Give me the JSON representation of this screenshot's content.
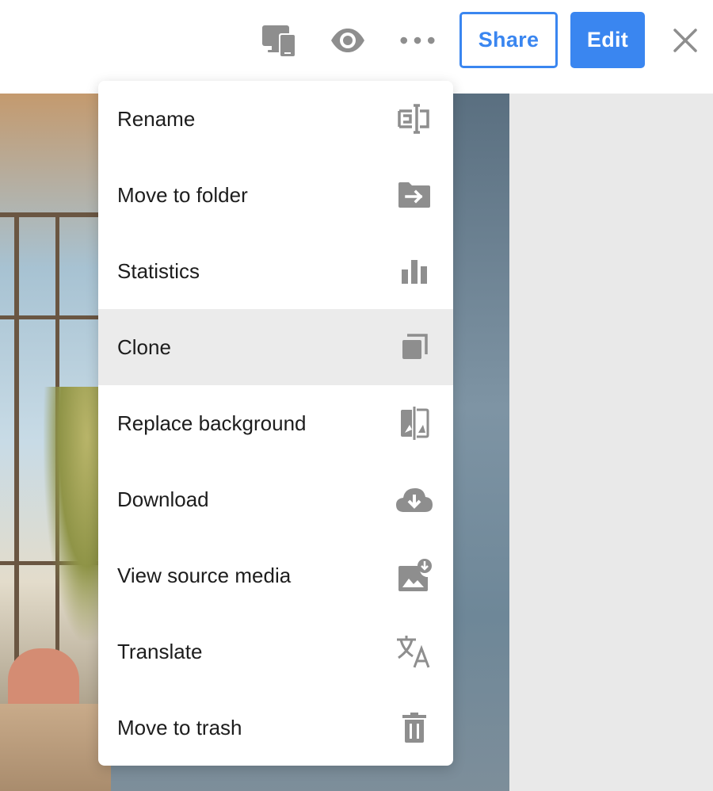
{
  "toolbar": {
    "share_label": "Share",
    "edit_label": "Edit",
    "icons": [
      "devices-icon",
      "eye-icon",
      "more-icon",
      "close-icon"
    ]
  },
  "menu": {
    "items": [
      {
        "label": "Rename",
        "icon": "rename-icon"
      },
      {
        "label": "Move to folder",
        "icon": "folder-move-icon"
      },
      {
        "label": "Statistics",
        "icon": "bar-chart-icon"
      },
      {
        "label": "Clone",
        "icon": "clone-icon",
        "highlighted": true
      },
      {
        "label": "Replace background",
        "icon": "replace-background-icon"
      },
      {
        "label": "Download",
        "icon": "cloud-download-icon"
      },
      {
        "label": "View source media",
        "icon": "image-download-icon"
      },
      {
        "label": "Translate",
        "icon": "translate-icon"
      },
      {
        "label": "Move to trash",
        "icon": "trash-icon"
      }
    ]
  },
  "colors": {
    "accent": "#3a86f0",
    "icon_gray": "#8e8e8e",
    "highlight": "#ebebeb",
    "panel": "#e9e9e9"
  }
}
